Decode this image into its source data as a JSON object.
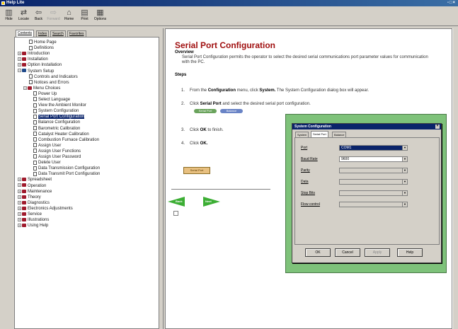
{
  "window": {
    "title": "Help Lite",
    "controls": "-□×"
  },
  "toolbar": {
    "items": [
      {
        "label": "Hide",
        "icon": "hide-icon",
        "enabled": true
      },
      {
        "label": "Locate",
        "icon": "locate-icon",
        "enabled": true
      },
      {
        "label": "Back",
        "icon": "back-icon",
        "enabled": true
      },
      {
        "label": "Forward",
        "icon": "forward-icon",
        "enabled": false
      },
      {
        "label": "Home",
        "icon": "home-icon",
        "enabled": true
      },
      {
        "label": "Print",
        "icon": "print-icon",
        "enabled": true
      },
      {
        "label": "Options",
        "icon": "options-icon",
        "enabled": true
      }
    ]
  },
  "nav_tabs": [
    "Contents",
    "Index",
    "Search",
    "Favorites"
  ],
  "tree": [
    {
      "label": "Home Page",
      "type": "page",
      "level": 1
    },
    {
      "label": "Definitions",
      "type": "page",
      "level": 1
    },
    {
      "label": "Introduction",
      "type": "book",
      "level": 0,
      "expander": "+"
    },
    {
      "label": "Installation",
      "type": "book",
      "level": 0,
      "expander": "+"
    },
    {
      "label": "Option Installation",
      "type": "book",
      "level": 0,
      "expander": "+"
    },
    {
      "label": "System Setup",
      "type": "book-open",
      "level": 0,
      "expander": "-"
    },
    {
      "label": "Controls and Indicators",
      "type": "page",
      "level": 1
    },
    {
      "label": "Notices and Errors",
      "type": "page",
      "level": 1
    },
    {
      "label": "Menu Choices",
      "type": "book",
      "level": 1,
      "expander": "+"
    },
    {
      "label": "Power Up",
      "type": "page",
      "level": 2
    },
    {
      "label": "Select Language",
      "type": "page",
      "level": 2
    },
    {
      "label": "View the Ambient Monitor",
      "type": "page",
      "level": 2
    },
    {
      "label": "System Configuration",
      "type": "page",
      "level": 2
    },
    {
      "label": "Serial Port Configuration",
      "type": "page",
      "level": 2,
      "selected": true
    },
    {
      "label": "Balance Configuration",
      "type": "page",
      "level": 2
    },
    {
      "label": "Barometric Calibration",
      "type": "page",
      "level": 2
    },
    {
      "label": "Catalyst Heater Calibration",
      "type": "page",
      "level": 2
    },
    {
      "label": "Combustion Furnace Calibration",
      "type": "page",
      "level": 2
    },
    {
      "label": "Assign User",
      "type": "page",
      "level": 2
    },
    {
      "label": "Assign User Functions",
      "type": "page",
      "level": 2
    },
    {
      "label": "Assign User Password",
      "type": "page",
      "level": 2
    },
    {
      "label": "Delete User",
      "type": "page",
      "level": 2
    },
    {
      "label": "Data Transmission Configuration",
      "type": "page",
      "level": 2
    },
    {
      "label": "Data Transmit Port Configuration",
      "type": "page",
      "level": 2
    },
    {
      "label": "Spreadsheet",
      "type": "book",
      "level": 0,
      "expander": "+"
    },
    {
      "label": "Operation",
      "type": "book",
      "level": 0,
      "expander": "+"
    },
    {
      "label": "Maintenance",
      "type": "book",
      "level": 0,
      "expander": "+"
    },
    {
      "label": "Theory",
      "type": "book",
      "level": 0,
      "expander": "+"
    },
    {
      "label": "Diagnostics",
      "type": "book",
      "level": 0,
      "expander": "+"
    },
    {
      "label": "Electronics Adjustments",
      "type": "book",
      "level": 0,
      "expander": "+"
    },
    {
      "label": "Service",
      "type": "book",
      "level": 0,
      "expander": "+"
    },
    {
      "label": "Illustrations",
      "type": "book",
      "level": 0,
      "expander": "+"
    },
    {
      "label": "Using Help",
      "type": "book",
      "level": 0,
      "expander": "+"
    }
  ],
  "content": {
    "title": "Serial Port Configuration",
    "overview_heading": "Overview",
    "overview_text": "Serial Port Configuration permits the operator to select the desired serial communications port parameter values for communication with the PC.",
    "steps_heading": "Steps",
    "steps": [
      {
        "num": "1.",
        "pre": "From the ",
        "bold": "Configuration",
        "mid": " menu, click ",
        "bold2": "System.",
        "post": " The System Configuration dialog box will appear."
      },
      {
        "num": "2.",
        "pre": "Click ",
        "bold": "Serial Port",
        "mid": " and select the desired serial port configuration.",
        "bold2": "",
        "post": ""
      },
      {
        "num": "3.",
        "pre": "Click ",
        "bold": "OK",
        "mid": " to finish.",
        "bold2": "",
        "post": ""
      },
      {
        "num": "4.",
        "pre": "Click ",
        "bold": "OK.",
        "mid": "",
        "bold2": "",
        "post": ""
      }
    ],
    "pill_green": "Serial Port",
    "pill_blue": "Balance",
    "image_button": "Serial Port",
    "nav_back": "Back",
    "nav_next": "Next"
  },
  "dialog": {
    "title": "System Configuration",
    "tabs": [
      "System",
      "Serial Port",
      "Balance"
    ],
    "fields": [
      {
        "label": "Port",
        "value": "COM1",
        "state": "selected"
      },
      {
        "label": "Baud Rate",
        "value": "9600",
        "state": "enabled"
      },
      {
        "label": "Parity",
        "value": "",
        "state": "disabled"
      },
      {
        "label": "Data",
        "value": "",
        "state": "disabled"
      },
      {
        "label": "Stop Bits",
        "value": "",
        "state": "disabled"
      },
      {
        "label": "Flow control",
        "value": "",
        "state": "disabled"
      }
    ],
    "buttons": [
      "OK",
      "Cancel",
      "Apply",
      "Help"
    ]
  }
}
